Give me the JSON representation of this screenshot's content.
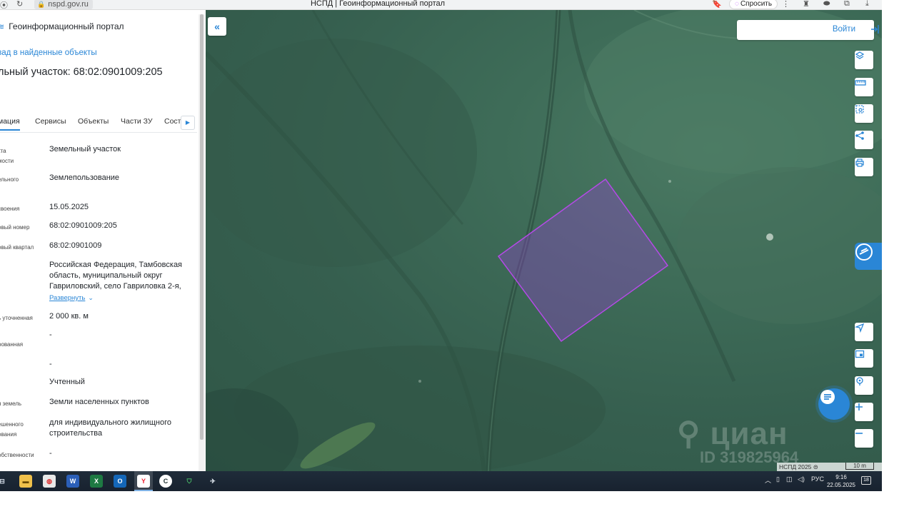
{
  "browser": {
    "url": "nspd.gov.ru",
    "tab_title": "НСПД | Геоинформационный портал",
    "ask_button": "Спросить"
  },
  "sidebar": {
    "brand": "Геоинформационный портал",
    "back_link": "зад в найденные объекты",
    "title": "льный участок: 68:02:0901009:205",
    "tabs": [
      "мация",
      "Сервисы",
      "Объекты",
      "Части ЗУ",
      "Соста"
    ],
    "expand_label": "Развернуть",
    "attributes": [
      {
        "label": "кта\nмости",
        "value": "Земельный участок"
      },
      {
        "label": "ельного",
        "value": "Землепользование"
      },
      {
        "label": "своения",
        "value": "15.05.2025"
      },
      {
        "label": "овый номер",
        "value": "68:02:0901009:205"
      },
      {
        "label": "овый квартал",
        "value": "68:02:0901009"
      },
      {
        "label": "",
        "value": "Российская Федерация, Тамбовская область, муниципальный округ Гавриловский, село Гавриловка 2-я,"
      },
      {
        "label": "ь уточненная",
        "value": "2 000 кв. м"
      },
      {
        "label": "рованная",
        "value": "-"
      },
      {
        "label": "",
        "value": "-"
      },
      {
        "label": "",
        "value": "Учтенный"
      },
      {
        "label": "я земель",
        "value": "Земли населенных пунктов"
      },
      {
        "label": "ешенного\nования",
        "value": "для индивидуального жилищного строительства"
      },
      {
        "label": "обственности",
        "value": "-"
      }
    ]
  },
  "map": {
    "login_label": "Войти",
    "watermark": "циан",
    "watermark_id": "ID 319825964",
    "attribution": "НСПД 2025",
    "scale_label": "10 m",
    "parcel_color": "#9b3fd6",
    "accent_color": "#2a86d6"
  },
  "taskbar": {
    "lang": "РУС",
    "time": "9:16",
    "date": "22.05.2025",
    "notifications": "18"
  }
}
